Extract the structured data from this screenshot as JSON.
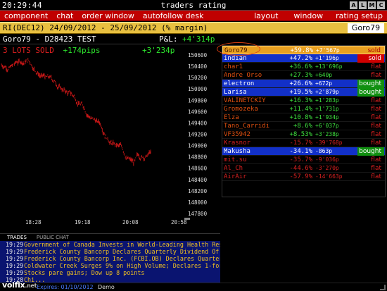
{
  "titlebar": {
    "clock": "20:29:44",
    "title": "traders rating",
    "buttons": [
      "A",
      "L",
      "M",
      "C"
    ]
  },
  "menu": {
    "left": [
      "component",
      "chat",
      "order window",
      "autofollow desk"
    ],
    "right": [
      "layout",
      "window",
      "rating setup"
    ]
  },
  "instrument": {
    "text": "RI(DEC12) 24/09/2012 - 25/09/2012 (% margin)",
    "user": "Goro79"
  },
  "position": {
    "account": "Goro79 - D28423 TEST",
    "pnl_label": "P&L:",
    "pnl_value": "+4'314p",
    "lots": "3 LOTS SOLD",
    "pips": "+174pips",
    "profit": "+3'234p"
  },
  "chart_data": {
    "type": "bar",
    "price_labels": [
      "150600",
      "150400",
      "150200",
      "150000",
      "149800",
      "149600",
      "149400",
      "149200",
      "149000",
      "148800",
      "148600",
      "148400",
      "148200",
      "148000",
      "147800"
    ],
    "time_labels": [
      "18:28",
      "19:18",
      "20:08",
      "20:58"
    ],
    "ylim": [
      147800,
      150600
    ],
    "series_color": "#d01818"
  },
  "rating": [
    {
      "name": "Goro79",
      "pct": "+59.8%",
      "pips": "+7'567p",
      "status": "sold",
      "style": "first"
    },
    {
      "name": "indian",
      "pct": "+47.2%",
      "pips": "+1'196p",
      "status": "sold",
      "style": "hl"
    },
    {
      "name": "char1",
      "pct": "+36.6%",
      "pips": "+13'696p",
      "status": "flat",
      "style": "normal"
    },
    {
      "name": "Andre Orso",
      "pct": "+27.3%",
      "pips": "+640p",
      "status": "flat",
      "style": "normal"
    },
    {
      "name": "electron",
      "pct": "+26.6%",
      "pips": "+672p",
      "status": "bought",
      "style": "hl"
    },
    {
      "name": "Larisa",
      "pct": "+19.5%",
      "pips": "+2'879p",
      "status": "bought",
      "style": "hl"
    },
    {
      "name": "VALINETCKIY",
      "pct": "+16.3%",
      "pips": "+1'283p",
      "status": "flat",
      "style": "normal"
    },
    {
      "name": "Gromozeka",
      "pct": "+11.4%",
      "pips": "+1'731p",
      "status": "flat",
      "style": "normal"
    },
    {
      "name": "Elza",
      "pct": "+10.8%",
      "pips": "+1'934p",
      "status": "flat",
      "style": "normal"
    },
    {
      "name": "Tano_Carridi",
      "pct": "+8.6%",
      "pips": "+6'037p",
      "status": "flat",
      "style": "normal"
    },
    {
      "name": "VF35942",
      "pct": "+8.53%",
      "pips": "+3'238p",
      "status": "flat",
      "style": "normal"
    },
    {
      "name": "Krasnor",
      "pct": "-15.7%",
      "pips": "-39'768p",
      "status": "flat",
      "style": "normal"
    },
    {
      "name": "Makusha",
      "pct": "-34.1%",
      "pips": "-863p",
      "status": "bought",
      "style": "hl"
    },
    {
      "name": "mit.su",
      "pct": "-35.7%",
      "pips": "-9'036p",
      "status": "flat",
      "style": "normal"
    },
    {
      "name": "Al_Ch",
      "pct": "-44.6%",
      "pips": "-3'270p",
      "status": "flat",
      "style": "normal"
    },
    {
      "name": "AirAir",
      "pct": "-57.9%",
      "pips": "-14'663p",
      "status": "flat",
      "style": "normal"
    }
  ],
  "news": {
    "tabs": [
      "TRADES",
      "PUBLIC CHAT"
    ],
    "items": [
      {
        "time": "19:29",
        "headline": "Government of Canada Invests in World-Leading Health Research"
      },
      {
        "time": "19:29",
        "headline": "Frederick County Bancorp Declares Quarterly Dividend Of $0"
      },
      {
        "time": "19:29",
        "headline": "Frederick County Bancorp Inc. (FCBI.OB) Declares Quarterly .."
      },
      {
        "time": "19:29",
        "headline": "Coldwater Creek Surges 9% on High Volume; Declares 1-for-4 R"
      },
      {
        "time": "19:29",
        "headline": "Stocks pare gains; Dow up 8 points"
      },
      {
        "time": "19:28",
        "headline": "Chi..."
      }
    ]
  },
  "footer": {
    "logo": "volfix",
    "logo_tld": ".net",
    "expires": "Expires: 01/10/2012",
    "mode": "Demo"
  }
}
